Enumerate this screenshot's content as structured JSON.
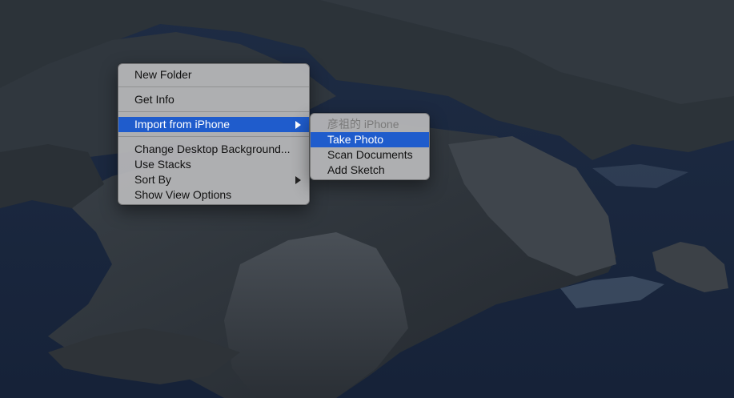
{
  "desktop": {
    "wallpaper_icon": "catalina-island-wallpaper"
  },
  "context_menu": {
    "items": [
      {
        "label": "New Folder"
      },
      {
        "label": "Get Info"
      },
      {
        "label": "Import from iPhone"
      },
      {
        "label": "Change Desktop Background..."
      },
      {
        "label": "Use Stacks"
      },
      {
        "label": "Sort By"
      },
      {
        "label": "Show View Options"
      }
    ]
  },
  "submenu": {
    "device_label": "彦祖的 iPhone",
    "items": [
      {
        "label": "Take Photo"
      },
      {
        "label": "Scan Documents"
      },
      {
        "label": "Add Sketch"
      }
    ]
  },
  "colors": {
    "highlight": "#1f5ccc",
    "menu_bg": "#b8b8ba"
  }
}
